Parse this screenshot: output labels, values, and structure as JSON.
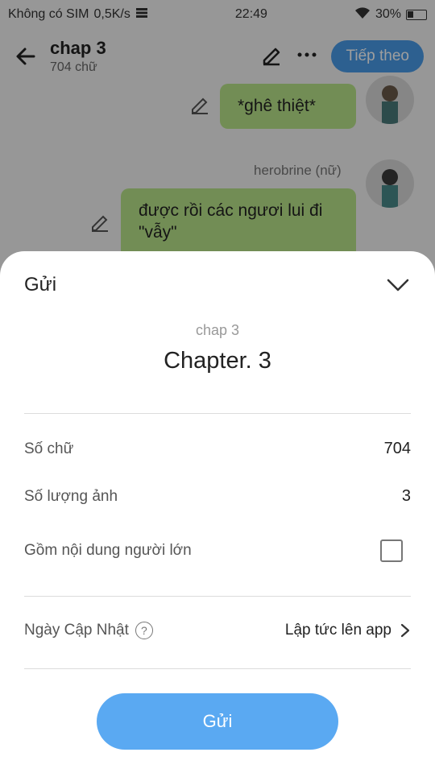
{
  "status_bar": {
    "carrier": "Không có SIM",
    "speed": "0,5K/s",
    "time": "22:49",
    "battery": "30%"
  },
  "header": {
    "title": "chap 3",
    "subtitle": "704 chữ",
    "next_label": "Tiếp theo"
  },
  "chat": {
    "messages": [
      {
        "text": "*ghê thiệt*"
      },
      {
        "sender": "herobrine (nữ)",
        "text": "được rồi các ngươi lui đi \"vẫy\""
      }
    ]
  },
  "sheet": {
    "title": "Gửi",
    "chapter_sub": "chap 3",
    "chapter_main": "Chapter. 3",
    "rows": [
      {
        "label": "Số chữ",
        "value": "704"
      },
      {
        "label": "Số lượng ảnh",
        "value": "3"
      }
    ],
    "adult_label": "Gồm nội dung người lớn",
    "adult_checked": false,
    "update_label": "Ngày Cập Nhật",
    "update_value": "Lập tức lên app",
    "send_label": "Gửi"
  },
  "colors": {
    "accent": "#5aa9f2",
    "next_button": "#4a9be8",
    "bubble": "#b9e48a"
  }
}
